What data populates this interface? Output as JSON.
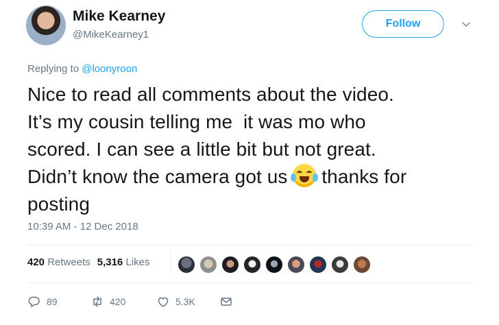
{
  "user": {
    "name": "Mike Kearney",
    "handle": "@MikeKearney1"
  },
  "follow": {
    "label": "Follow"
  },
  "reply": {
    "prefix": "Replying to ",
    "mention": "@loonyroon"
  },
  "tweet": {
    "line1": "Nice to read all comments about the video.",
    "line2": "It’s my cousin telling me  it was mo who",
    "line3": "scored. I can see a little bit but not great.",
    "line4_before": "Didn’t know the camera got us ",
    "line4_after": " thanks for",
    "line5": "posting",
    "emoji": "face-with-tears-of-joy"
  },
  "timestamp": "10:39 AM - 12 Dec 2018",
  "stats": {
    "retweets_count": "420",
    "retweets_label": "Retweets",
    "likes_count": "5,316",
    "likes_label": "Likes"
  },
  "actions": {
    "replies": "89",
    "retweets": "420",
    "likes": "5.3K"
  },
  "colors": {
    "accent": "#1da1f2",
    "secondary": "#657786",
    "text": "#14171a",
    "divider": "#e6ecf0"
  }
}
